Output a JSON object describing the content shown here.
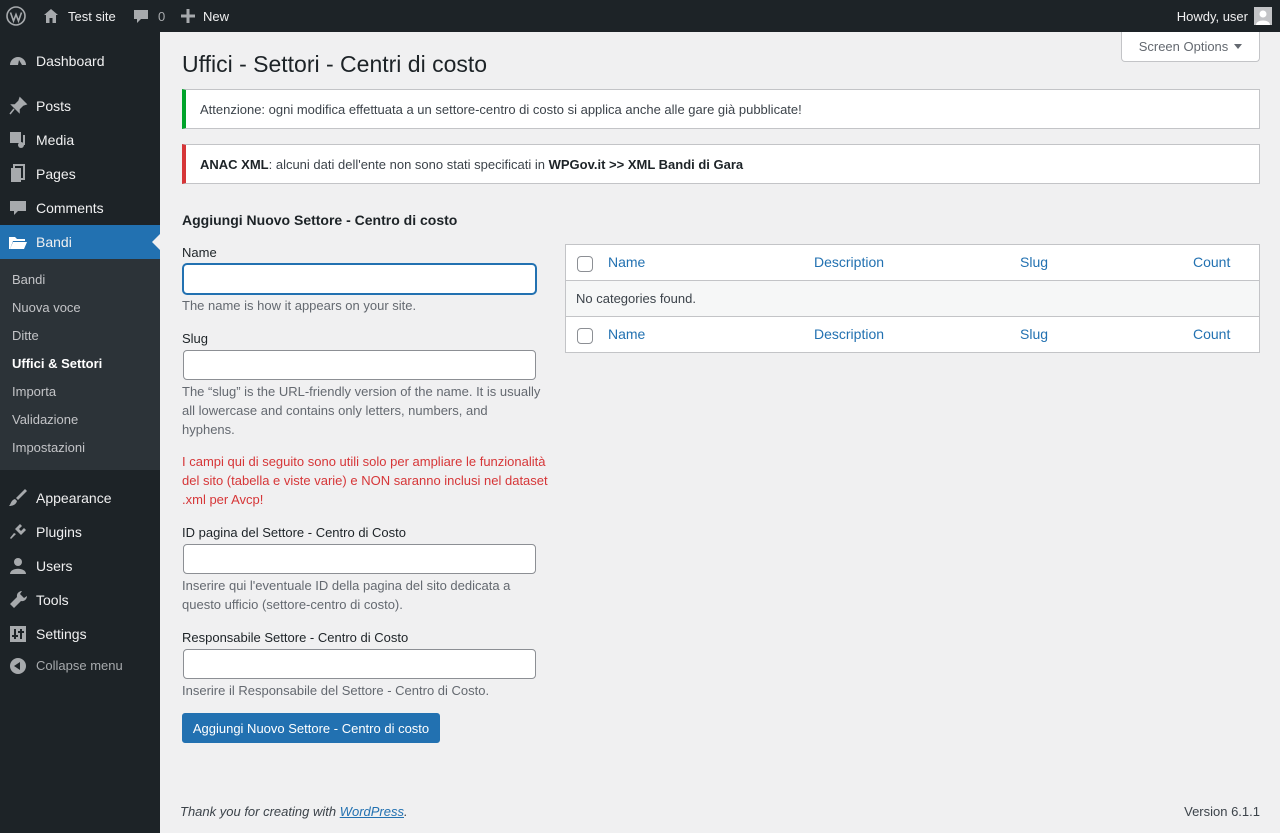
{
  "adminbar": {
    "site_name": "Test site",
    "comments_count": "0",
    "new_label": "New",
    "howdy": "Howdy, user"
  },
  "sidebar": {
    "items": [
      {
        "label": "Dashboard",
        "icon": "dashboard-icon"
      },
      {
        "label": "Posts",
        "icon": "pushpin-icon"
      },
      {
        "label": "Media",
        "icon": "media-icon"
      },
      {
        "label": "Pages",
        "icon": "pages-icon"
      },
      {
        "label": "Comments",
        "icon": "comment-icon"
      },
      {
        "label": "Bandi",
        "icon": "folder-open-icon"
      },
      {
        "label": "Appearance",
        "icon": "paintbrush-icon"
      },
      {
        "label": "Plugins",
        "icon": "plugin-icon"
      },
      {
        "label": "Users",
        "icon": "user-icon"
      },
      {
        "label": "Tools",
        "icon": "wrench-icon"
      },
      {
        "label": "Settings",
        "icon": "sliders-icon"
      }
    ],
    "submenu": [
      "Bandi",
      "Nuova voce",
      "Ditte",
      "Uffici & Settori",
      "Importa",
      "Validazione",
      "Impostazioni"
    ],
    "collapse_label": "Collapse menu"
  },
  "screen_options": "Screen Options",
  "page_title": "Uffici - Settori - Centri di costo",
  "notices": {
    "success_text": "Attenzione: ogni modifica effettuata a un settore-centro di costo si applica anche alle gare già pubblicate!",
    "error_bold1": "ANAC XML",
    "error_text": ": alcuni dati dell'ente non sono stati specificati in ",
    "error_bold2": "WPGov.it >> XML Bandi di Gara"
  },
  "form": {
    "heading": "Aggiungi Nuovo Settore - Centro di costo",
    "name_label": "Name",
    "name_value": "",
    "name_help": "The name is how it appears on your site.",
    "slug_label": "Slug",
    "slug_value": "",
    "slug_help": "The “slug” is the URL-friendly version of the name. It is usually all lowercase and contains only letters, numbers, and hyphens.",
    "warning": "I campi qui di seguito sono utili solo per ampliare le funzionalità del sito (tabella e viste varie) e NON saranno inclusi nel dataset .xml per Avcp!",
    "page_id_label": "ID pagina del Settore - Centro di Costo",
    "page_id_value": "",
    "page_id_help": "Inserire qui l'eventuale ID della pagina del sito dedicata a questo ufficio (settore-centro di costo).",
    "manager_label": "Responsabile Settore - Centro di Costo",
    "manager_value": "",
    "manager_help": "Inserire il Responsabile del Settore - Centro di Costo.",
    "submit_label": "Aggiungi Nuovo Settore - Centro di costo"
  },
  "table": {
    "columns": [
      "Name",
      "Description",
      "Slug",
      "Count"
    ],
    "empty_message": "No categories found."
  },
  "footer": {
    "thanks_prefix": "Thank you for creating with ",
    "thanks_link": "WordPress",
    "thanks_suffix": ".",
    "version": "Version 6.1.1"
  },
  "colors": {
    "admin_dark": "#1d2327",
    "accent_blue": "#2271b1",
    "success_green": "#00a32a",
    "error_red": "#d63638"
  }
}
